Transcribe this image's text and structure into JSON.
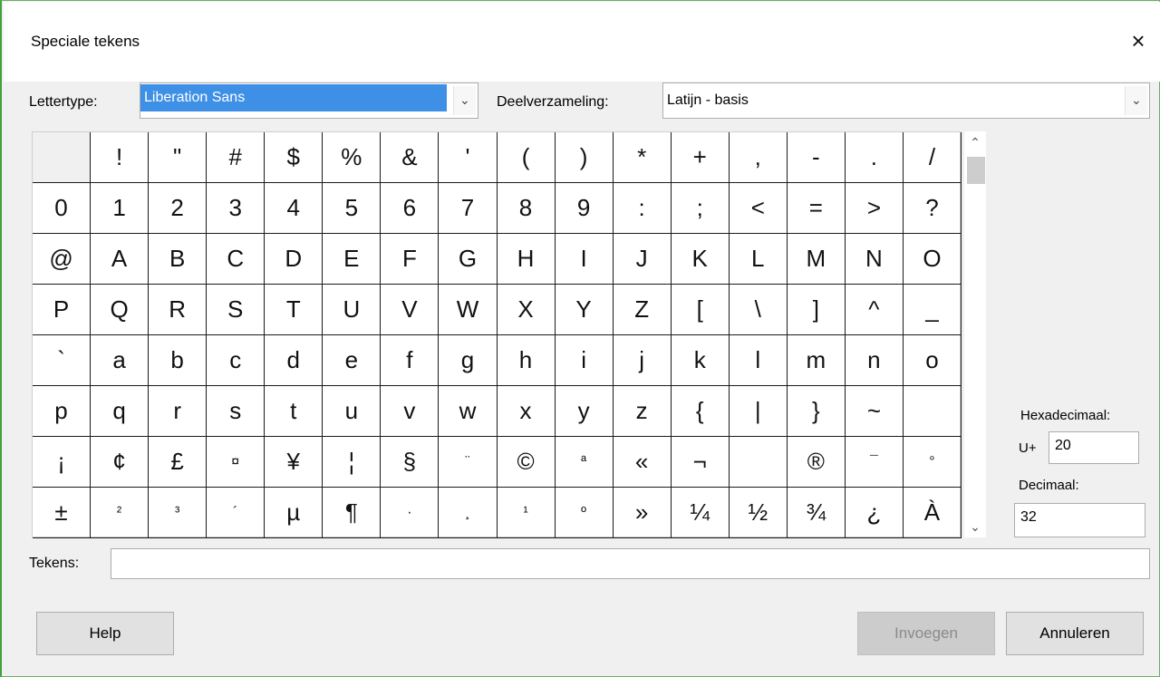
{
  "window": {
    "title": "Speciale tekens",
    "close_icon": "×"
  },
  "font": {
    "label": "Lettertype:",
    "value": "Liberation Sans",
    "arrow": "⌄"
  },
  "subset": {
    "label": "Deelverzameling:",
    "value": "Latijn - basis",
    "arrow": "⌄"
  },
  "grid": {
    "rows": [
      [
        " ",
        "!",
        "\"",
        "#",
        "$",
        "%",
        "&",
        "'",
        "(",
        ")",
        "*",
        "+",
        ",",
        "-",
        ".",
        "/"
      ],
      [
        "0",
        "1",
        "2",
        "3",
        "4",
        "5",
        "6",
        "7",
        "8",
        "9",
        ":",
        ";",
        "<",
        "=",
        ">",
        "?"
      ],
      [
        "@",
        "A",
        "B",
        "C",
        "D",
        "E",
        "F",
        "G",
        "H",
        "I",
        "J",
        "K",
        "L",
        "M",
        "N",
        "O"
      ],
      [
        "P",
        "Q",
        "R",
        "S",
        "T",
        "U",
        "V",
        "W",
        "X",
        "Y",
        "Z",
        "[",
        "\\",
        "]",
        "^",
        "_"
      ],
      [
        "`",
        "a",
        "b",
        "c",
        "d",
        "e",
        "f",
        "g",
        "h",
        "i",
        "j",
        "k",
        "l",
        "m",
        "n",
        "o"
      ],
      [
        "p",
        "q",
        "r",
        "s",
        "t",
        "u",
        "v",
        "w",
        "x",
        "y",
        "z",
        "{",
        "|",
        "}",
        "~",
        ""
      ],
      [
        "¡",
        "¢",
        "£",
        "¤",
        "¥",
        "¦",
        "§",
        "¨",
        "©",
        "ª",
        "«",
        "¬",
        "",
        "®",
        "¯",
        "°"
      ],
      [
        "±",
        "²",
        "³",
        "´",
        "µ",
        "¶",
        "·",
        "¸",
        "¹",
        "º",
        "»",
        "¼",
        "½",
        "¾",
        "¿",
        "À"
      ]
    ],
    "selected": [
      0,
      0
    ]
  },
  "scrollbar": {
    "up": "⌃",
    "down": "⌄"
  },
  "hex": {
    "label": "Hexadecimaal:",
    "prefix": "U+",
    "value": "20"
  },
  "decimal": {
    "label": "Decimaal:",
    "value": "32"
  },
  "chars": {
    "label": "Tekens:",
    "value": ""
  },
  "buttons": {
    "help": "Help",
    "insert": "Invoegen",
    "cancel": "Annuleren"
  }
}
